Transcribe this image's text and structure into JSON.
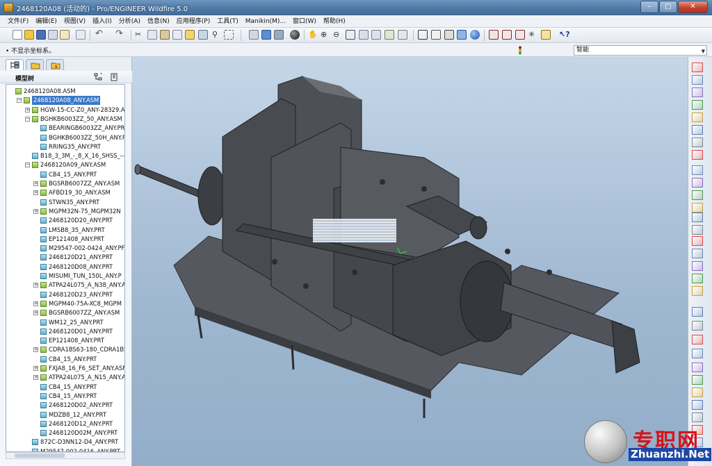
{
  "window": {
    "title": "2468120A08 (活动的) - Pro/ENGINEER Wildfire 5.0",
    "buttons": {
      "minimize": "–",
      "maximize": "□",
      "close": "✕"
    }
  },
  "menu": [
    "文件(F)",
    "编辑(E)",
    "视图(V)",
    "插入(I)",
    "分析(A)",
    "信息(N)",
    "应用程序(P)",
    "工具(T)",
    "Manikin(M)...",
    "窗口(W)",
    "帮助(H)"
  ],
  "message": "• 不显示坐标系。",
  "smart_filter": "智能",
  "tree": {
    "title": "模型树",
    "items": [
      {
        "label": "2468120A08.ASM",
        "level": 0,
        "expander": "",
        "type": "asm"
      },
      {
        "label": "2468120A08_ANY.ASM",
        "level": 1,
        "expander": "−",
        "type": "asm",
        "selected": true
      },
      {
        "label": "HGW-15-CC-Z0_ANY-28329.A",
        "level": 2,
        "expander": "+",
        "type": "asm"
      },
      {
        "label": "BGHKB6003ZZ_50_ANY.ASM",
        "level": 2,
        "expander": "−",
        "type": "asm"
      },
      {
        "label": "BEARINGB6003ZZ_ANY.PR",
        "level": 3,
        "expander": "",
        "type": "part"
      },
      {
        "label": "BGHKB6003ZZ_50H_ANY.P",
        "level": 3,
        "expander": "",
        "type": "part"
      },
      {
        "label": "RRING35_ANY.PRT",
        "level": 3,
        "expander": "",
        "type": "part"
      },
      {
        "label": "B18_3_3M_-_8_X_16_SHSS_--N",
        "level": 2,
        "expander": "",
        "type": "part"
      },
      {
        "label": "2468120A09_ANY.ASM",
        "level": 2,
        "expander": "−",
        "type": "asm"
      },
      {
        "label": "CB4_15_ANY.PRT",
        "level": 3,
        "expander": "",
        "type": "part"
      },
      {
        "label": "BGSRB6007ZZ_ANY.ASM",
        "level": 3,
        "expander": "+",
        "type": "asm"
      },
      {
        "label": "AFBD19_30_ANY.ASM",
        "level": 3,
        "expander": "+",
        "type": "asm"
      },
      {
        "label": "STWN35_ANY.PRT",
        "level": 3,
        "expander": "",
        "type": "part"
      },
      {
        "label": "MGPM32N-75_MGPM32N",
        "level": 3,
        "expander": "+",
        "type": "asm"
      },
      {
        "label": "2468120D20_ANY.PRT",
        "level": 3,
        "expander": "",
        "type": "part"
      },
      {
        "label": "LMSB8_35_ANY.PRT",
        "level": 3,
        "expander": "",
        "type": "part"
      },
      {
        "label": "EP121408_ANY.PRT",
        "level": 3,
        "expander": "",
        "type": "part"
      },
      {
        "label": "M29547-002-0424_ANY.PF",
        "level": 3,
        "expander": "",
        "type": "part"
      },
      {
        "label": "2468120D21_ANY.PRT",
        "level": 3,
        "expander": "",
        "type": "part"
      },
      {
        "label": "2468120D08_ANY.PRT",
        "level": 3,
        "expander": "",
        "type": "part"
      },
      {
        "label": "MISUMI_TUN_150L_ANY.P",
        "level": 3,
        "expander": "",
        "type": "part"
      },
      {
        "label": "ATPA24L075_A_N38_ANY.A",
        "level": 3,
        "expander": "+",
        "type": "asm"
      },
      {
        "label": "2468120D23_ANY.PRT",
        "level": 3,
        "expander": "",
        "type": "part"
      },
      {
        "label": "MGPM40-75A-XC8_MGPM",
        "level": 3,
        "expander": "+",
        "type": "asm"
      },
      {
        "label": "BGSRB6007ZZ_ANY.ASM",
        "level": 3,
        "expander": "+",
        "type": "asm"
      },
      {
        "label": "WM12_25_ANY.PRT",
        "level": 3,
        "expander": "",
        "type": "part"
      },
      {
        "label": "2468120D01_ANY.PRT",
        "level": 3,
        "expander": "",
        "type": "part"
      },
      {
        "label": "EP121408_ANY.PRT",
        "level": 3,
        "expander": "",
        "type": "part"
      },
      {
        "label": "CDRA1BS63-180_CDRA1BS",
        "level": 3,
        "expander": "+",
        "type": "asm"
      },
      {
        "label": "CB4_15_ANY.PRT",
        "level": 3,
        "expander": "",
        "type": "part"
      },
      {
        "label": "FXJA8_16_F6_SET_ANY.ASM",
        "level": 3,
        "expander": "+",
        "type": "asm"
      },
      {
        "label": "ATPA24L075_A_N15_ANY.A",
        "level": 3,
        "expander": "+",
        "type": "asm"
      },
      {
        "label": "CB4_15_ANY.PRT",
        "level": 3,
        "expander": "",
        "type": "part"
      },
      {
        "label": "CB4_15_ANY.PRT",
        "level": 3,
        "expander": "",
        "type": "part"
      },
      {
        "label": "2468120D02_ANY.PRT",
        "level": 3,
        "expander": "",
        "type": "part"
      },
      {
        "label": "MDZB8_12_ANY.PRT",
        "level": 3,
        "expander": "",
        "type": "part"
      },
      {
        "label": "2468120D12_ANY.PRT",
        "level": 3,
        "expander": "",
        "type": "part"
      },
      {
        "label": "2468120D02M_ANY.PRT",
        "level": 3,
        "expander": "",
        "type": "part"
      },
      {
        "label": "872C-D3NN12-D4_ANY.PRT",
        "level": 2,
        "expander": "",
        "type": "part"
      },
      {
        "label": "M29547-002-0416_ANY.PRT",
        "level": 2,
        "expander": "",
        "type": "part"
      }
    ]
  },
  "watermark": {
    "text": "专职网",
    "url": "Zhuanzhi.Net"
  },
  "colors": {
    "title_bar": "#4e7aa6",
    "viewport_bg": "#a9bfd6",
    "model": "#4a4d52",
    "selection": "#3a79c6",
    "watermark_red": "#d4141a"
  },
  "icons": {
    "top_toolbar": [
      "new",
      "open",
      "save",
      "print",
      "email",
      "undo",
      "redo",
      "cut",
      "copy",
      "paste",
      "regenerate",
      "find",
      "select",
      "repaint",
      "spin-center",
      "orient",
      "zoom-in",
      "zoom-out",
      "refit",
      "reorient",
      "saved-views",
      "layers",
      "wireframe",
      "hidden",
      "no-hidden",
      "shading",
      "enhanced-realism",
      "datum-planes",
      "datum-axes",
      "datum-points",
      "csys",
      "annotations",
      "help"
    ],
    "right_toolbar": [
      "datum-plane",
      "sketch",
      "datum-axis",
      "datum-curve",
      "datum-point",
      "csys",
      "analysis",
      "extrude",
      "revolve",
      "sweep",
      "blend",
      "round",
      "chamfer",
      "hole",
      "rib",
      "draft",
      "shell",
      "pattern",
      "mirror",
      "merge",
      "trim",
      "extend",
      "offset",
      "thicken",
      "solidify"
    ]
  }
}
